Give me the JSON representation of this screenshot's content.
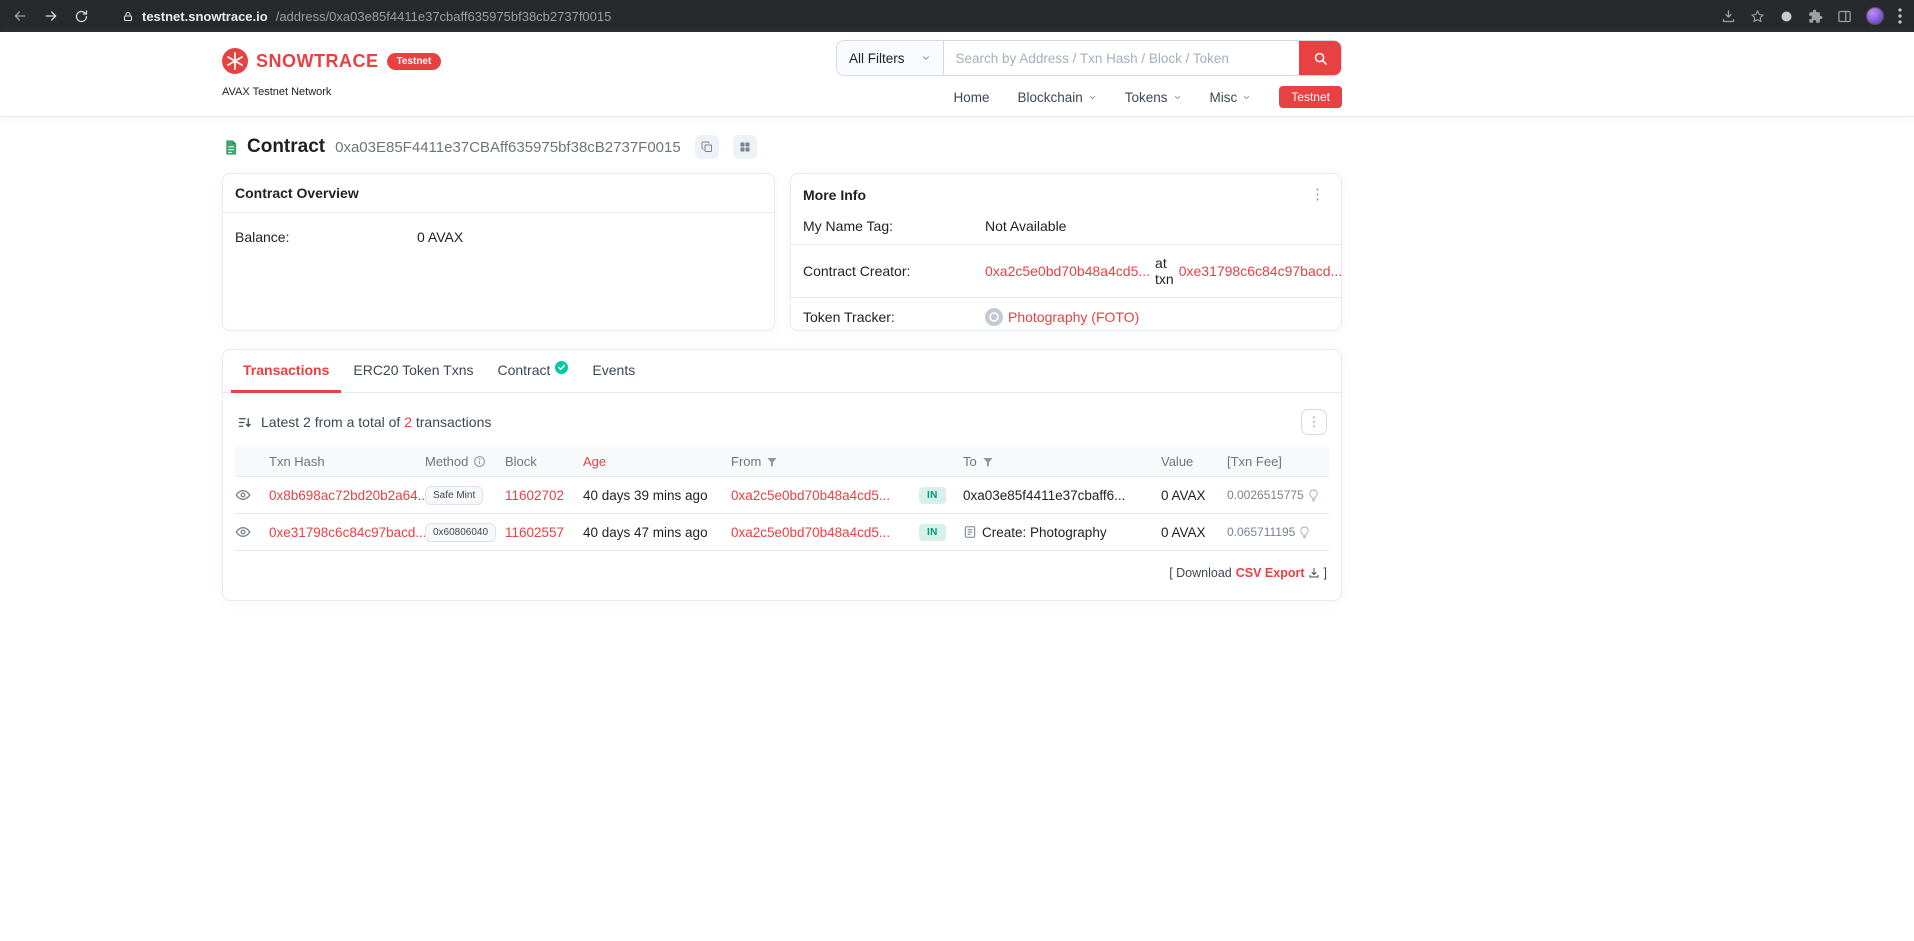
{
  "browser": {
    "url_domain": "testnet.snowtrace.io",
    "url_path": "/address/0xa03e85f4411e37cbaff635975bf38cb2737f0015"
  },
  "header": {
    "brand": "SNOWTRACE",
    "brand_badge": "Testnet",
    "network_label": "AVAX Testnet Network",
    "search": {
      "filter_label": "All Filters",
      "placeholder": "Search by Address / Txn Hash / Block / Token"
    },
    "nav": [
      {
        "label": "Home"
      },
      {
        "label": "Blockchain"
      },
      {
        "label": "Tokens"
      },
      {
        "label": "Misc"
      }
    ],
    "testnet_button": "Testnet"
  },
  "page": {
    "title": "Contract",
    "address": "0xa03E85F4411e37CBAff635975bf38cB2737F0015"
  },
  "overview": {
    "title": "Contract Overview",
    "balance_label": "Balance:",
    "balance_value": "0 AVAX"
  },
  "more_info": {
    "title": "More Info",
    "name_tag_label": "My Name Tag:",
    "name_tag_value": "Not Available",
    "creator_label": "Contract Creator:",
    "creator_address": "0xa2c5e0bd70b48a4cd5...",
    "at_txn": "at txn",
    "creator_txn": "0xe31798c6c84c97bacd...",
    "token_tracker_label": "Token Tracker:",
    "token_tracker_value": "Photography (FOTO)"
  },
  "tabs": [
    {
      "label": "Transactions"
    },
    {
      "label": "ERC20 Token Txns"
    },
    {
      "label": "Contract"
    },
    {
      "label": "Events"
    }
  ],
  "transactions": {
    "summary_prefix": "Latest 2 from a total of",
    "summary_count": "2",
    "summary_suffix": "transactions",
    "columns": {
      "txn_hash": "Txn Hash",
      "method": "Method",
      "block": "Block",
      "age": "Age",
      "from": "From",
      "to": "To",
      "value": "Value",
      "txn_fee": "[Txn Fee]"
    },
    "rows": [
      {
        "txn_hash": "0x8b698ac72bd20b2a64...",
        "method": "Safe Mint",
        "block": "11602702",
        "age": "40 days 39 mins ago",
        "from": "0xa2c5e0bd70b48a4cd5...",
        "direction": "IN",
        "to": "0xa03e85f4411e37cbaff6...",
        "value": "0 AVAX",
        "txn_fee": "0.0026515775"
      },
      {
        "txn_hash": "0xe31798c6c84c97bacd...",
        "method": "0x60806040",
        "block": "11602557",
        "age": "40 days 47 mins ago",
        "from": "0xa2c5e0bd70b48a4cd5...",
        "direction": "IN",
        "to": "Create: Photography",
        "value": "0 AVAX",
        "txn_fee": "0.065711195"
      }
    ],
    "download_prefix": "[ Download",
    "download_label": "CSV Export",
    "download_suffix": "]"
  },
  "colors": {
    "brand_red": "#e84142",
    "link_red": "#e84142",
    "in_badge_text": "#02977e",
    "in_badge_bg": "#d8f0ea"
  }
}
